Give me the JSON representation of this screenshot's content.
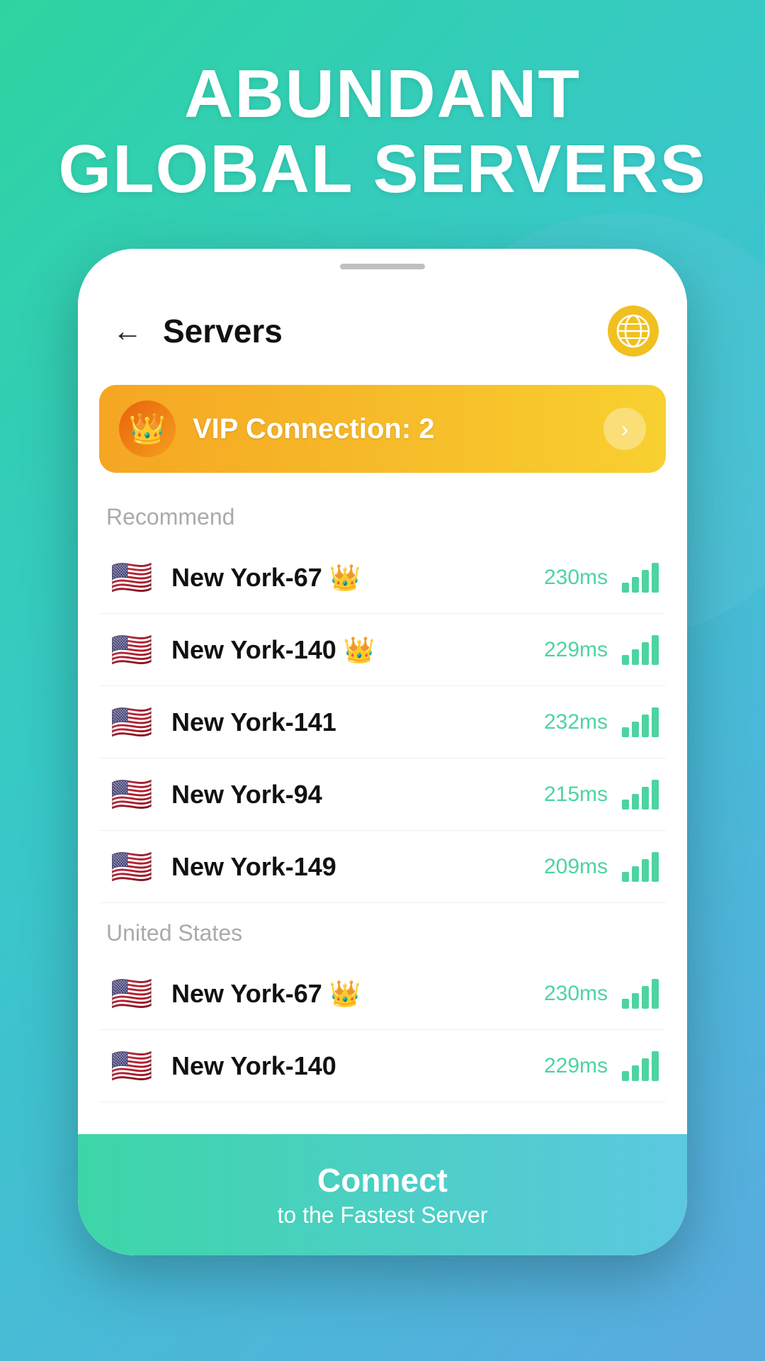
{
  "header": {
    "title_line1": "ABUNDANT",
    "title_line2": "GLOBAL SERVERS"
  },
  "app": {
    "back_label": "←",
    "title": "Servers",
    "vip": {
      "label": "VIP Connection: 2",
      "arrow": "›"
    },
    "sections": [
      {
        "name": "Recommend",
        "servers": [
          {
            "flag": "🇺🇸",
            "name": "New York-67",
            "vip": true,
            "latency": "230ms"
          },
          {
            "flag": "🇺🇸",
            "name": "New York-140",
            "vip": true,
            "latency": "229ms"
          },
          {
            "flag": "🇺🇸",
            "name": "New York-141",
            "vip": false,
            "latency": "232ms"
          },
          {
            "flag": "🇺🇸",
            "name": "New York-94",
            "vip": false,
            "latency": "215ms"
          },
          {
            "flag": "🇺🇸",
            "name": "New York-149",
            "vip": false,
            "latency": "209ms"
          }
        ]
      },
      {
        "name": "United States",
        "servers": [
          {
            "flag": "🇺🇸",
            "name": "New York-67",
            "vip": true,
            "latency": "230ms"
          },
          {
            "flag": "🇺🇸",
            "name": "New York-140",
            "vip": false,
            "latency": "229ms"
          }
        ]
      }
    ],
    "connect_button": {
      "line1": "Connect",
      "line2": "to the Fastest Server"
    }
  }
}
